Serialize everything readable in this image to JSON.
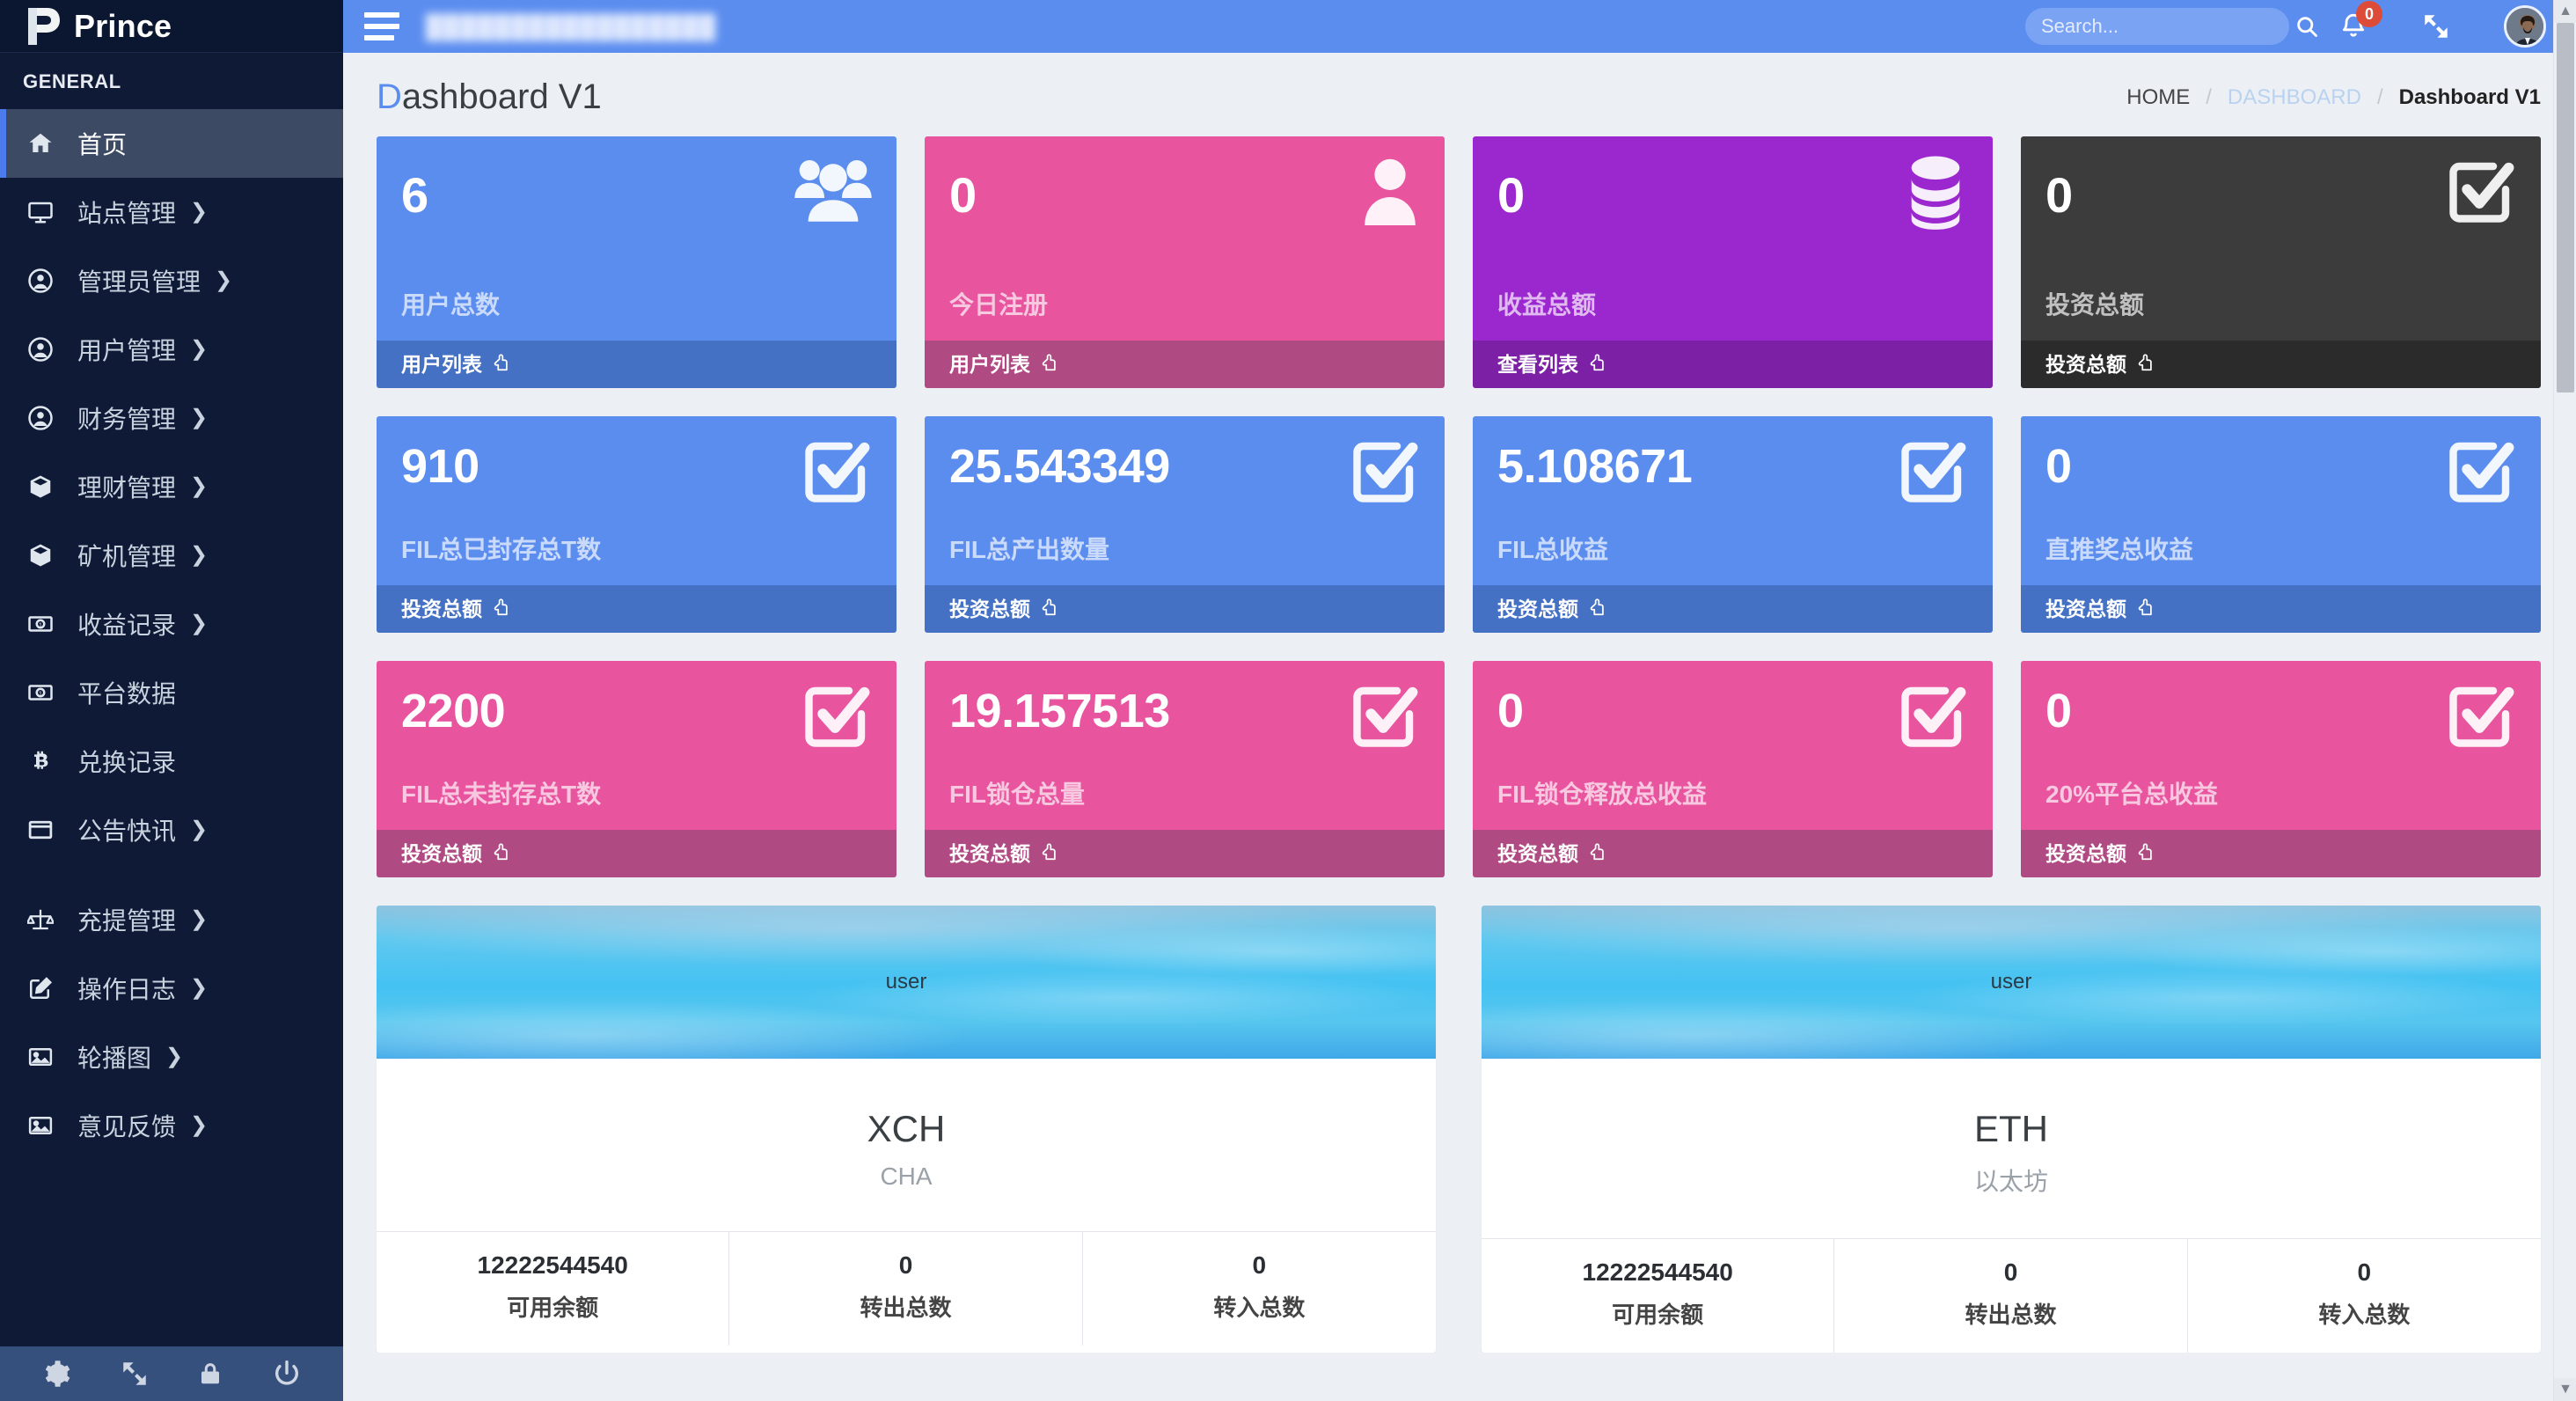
{
  "brand": {
    "name": "Prince",
    "logo_icon": "prince-p-logo"
  },
  "sidebar": {
    "section_title": "GENERAL",
    "items": [
      {
        "label": "首页",
        "icon": "home-icon",
        "caret": "",
        "active": true
      },
      {
        "label": "站点管理",
        "icon": "monitor-icon",
        "caret": "❯",
        "active": false
      },
      {
        "label": "管理员管理",
        "icon": "user-circle-icon",
        "caret": "❯",
        "active": false
      },
      {
        "label": "用户管理",
        "icon": "user-circle-icon",
        "caret": "❯",
        "active": false
      },
      {
        "label": "财务管理",
        "icon": "user-circle-icon",
        "caret": "❯",
        "active": false
      },
      {
        "label": "理财管理",
        "icon": "cube-icon",
        "caret": "❯",
        "active": false
      },
      {
        "label": "矿机管理",
        "icon": "cube-icon",
        "caret": "❯",
        "active": false
      },
      {
        "label": "收益记录",
        "icon": "money-bill-icon",
        "caret": "❯",
        "active": false
      },
      {
        "label": "平台数据",
        "icon": "money-bill-icon",
        "caret": "",
        "active": false
      },
      {
        "label": "兑换记录",
        "icon": "bitcoin-icon",
        "caret": "",
        "active": false
      },
      {
        "label": "公告快讯",
        "icon": "window-icon",
        "caret": "❯",
        "active": false
      },
      {
        "label": "充提管理",
        "icon": "balance-scale-icon",
        "caret": "❯",
        "active": false
      },
      {
        "label": "操作日志",
        "icon": "edit-note-icon",
        "caret": "❯",
        "active": false
      },
      {
        "label": "轮播图",
        "icon": "image-icon",
        "caret": "❯",
        "active": false
      },
      {
        "label": "意见反馈",
        "icon": "image-icon",
        "caret": "❯",
        "active": false
      }
    ],
    "footer_icons": [
      "gear-icon",
      "expand-arrows-icon",
      "lock-icon",
      "power-off-icon"
    ]
  },
  "navbar": {
    "menu_toggle_icon": "hamburger-icon",
    "title_redacted": "█████████████████",
    "search": {
      "placeholder": "Search...",
      "value": "",
      "icon": "search-icon"
    },
    "notifications": {
      "icon": "bell-icon",
      "count": "0"
    },
    "fullscreen_icon": "expand-arrows-icon",
    "avatar_icon": "user-avatar"
  },
  "page": {
    "title_first": "D",
    "title_rest": "ashboard V1",
    "breadcrumb": [
      {
        "label": "HOME",
        "type": "plain"
      },
      {
        "label": "DASHBOARD",
        "type": "link"
      },
      {
        "label": "Dashboard V1",
        "type": "current"
      }
    ],
    "breadcrumb_separator": "/"
  },
  "colors": {
    "blue": "#5b8def",
    "blue_dark": "#4571c4",
    "pink": "#e8549e",
    "pink_dark": "#b04a82",
    "purple": "#9b27cf",
    "purple_dark": "#7c21a6",
    "dark": "#3c3c3c",
    "dark_darker": "#2b2b2b",
    "sidebar": "#0e1a36",
    "body_bg": "#ecf0f5",
    "badge_red": "#dd4b39"
  },
  "stat_rows": [
    {
      "cards": [
        {
          "value": "6",
          "label": "用户总数",
          "footer": "用户列表",
          "icon": "users-icon",
          "color": "blue",
          "footer_icon": "hand-point-up-icon"
        },
        {
          "value": "0",
          "label": "今日注册",
          "footer": "用户列表",
          "icon": "user-icon",
          "color": "pink",
          "footer_icon": "hand-point-up-icon"
        },
        {
          "value": "0",
          "label": "收益总额",
          "footer": "查看列表",
          "icon": "database-icon",
          "color": "purple",
          "footer_icon": "hand-point-up-icon"
        },
        {
          "value": "0",
          "label": "投资总额",
          "footer": "投资总额",
          "icon": "check-square-icon",
          "color": "dark",
          "footer_icon": "hand-point-up-icon"
        }
      ]
    },
    {
      "cards": [
        {
          "value": "910",
          "label": "FIL总已封存总T数",
          "footer": "投资总额",
          "icon": "check-square-icon",
          "color": "blue",
          "footer_icon": "hand-point-up-icon"
        },
        {
          "value": "25.543349",
          "label": "FIL总产出数量",
          "footer": "投资总额",
          "icon": "check-square-icon",
          "color": "blue",
          "footer_icon": "hand-point-up-icon"
        },
        {
          "value": "5.108671",
          "label": "FIL总收益",
          "footer": "投资总额",
          "icon": "check-square-icon",
          "color": "blue",
          "footer_icon": "hand-point-up-icon"
        },
        {
          "value": "0",
          "label": "直推奖总收益",
          "footer": "投资总额",
          "icon": "check-square-icon",
          "color": "blue",
          "footer_icon": "hand-point-up-icon"
        }
      ]
    },
    {
      "cards": [
        {
          "value": "2200",
          "label": "FIL总未封存总T数",
          "footer": "投资总额",
          "icon": "check-square-icon",
          "color": "pink",
          "footer_icon": "hand-point-up-icon"
        },
        {
          "value": "19.157513",
          "label": "FIL锁仓总量",
          "footer": "投资总额",
          "icon": "check-square-icon",
          "color": "pink",
          "footer_icon": "hand-point-up-icon"
        },
        {
          "value": "0",
          "label": "FIL锁仓释放总收益",
          "footer": "投资总额",
          "icon": "check-square-icon",
          "color": "pink",
          "footer_icon": "hand-point-up-icon"
        },
        {
          "value": "0",
          "label": "20%平台总收益",
          "footer": "投资总额",
          "icon": "check-square-icon",
          "color": "pink",
          "footer_icon": "hand-point-up-icon"
        }
      ]
    }
  ],
  "widgets": [
    {
      "banner_user": "user",
      "symbol": "XCH",
      "subtitle": "CHA",
      "stats": [
        {
          "value": "12222544540",
          "key": "可用余额"
        },
        {
          "value": "0",
          "key": "转出总数"
        },
        {
          "value": "0",
          "key": "转入总数"
        }
      ]
    },
    {
      "banner_user": "user",
      "symbol": "ETH",
      "subtitle": "以太坊",
      "stats": [
        {
          "value": "12222544540",
          "key": "可用余额"
        },
        {
          "value": "0",
          "key": "转出总数"
        },
        {
          "value": "0",
          "key": "转入总数"
        }
      ]
    }
  ]
}
